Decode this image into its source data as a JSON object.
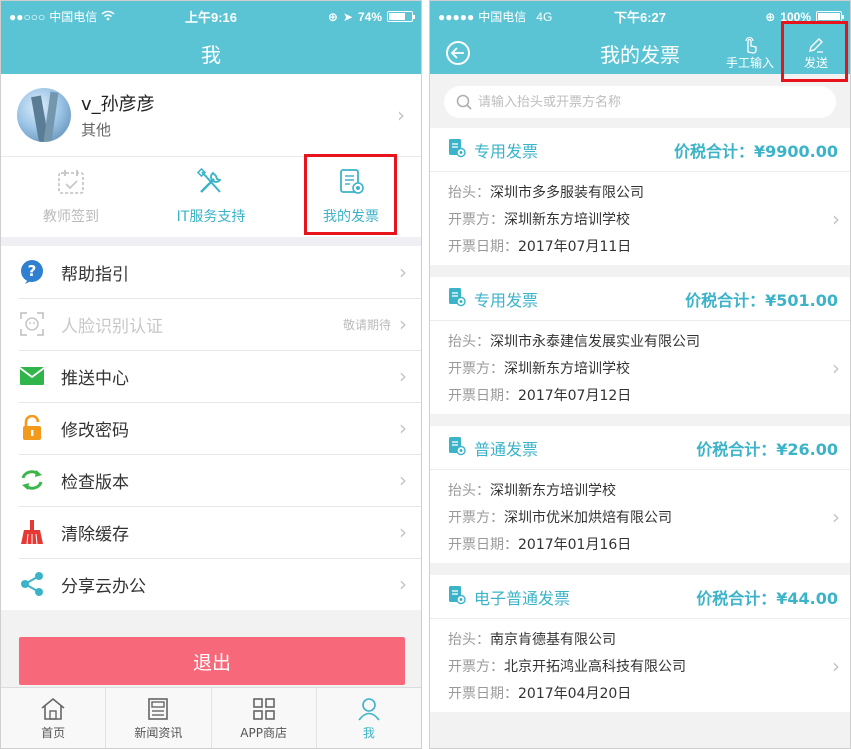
{
  "left": {
    "status": {
      "carrier": "中国电信",
      "time": "上午9:16",
      "battery": "74%",
      "battery_level": 0.74
    },
    "title": "我",
    "profile": {
      "name": "v_孙彦彦",
      "role": "其他"
    },
    "shortcuts": [
      {
        "label": "教师签到",
        "icon": "calendar-check-icon"
      },
      {
        "label": "IT服务支持",
        "icon": "tools-icon"
      },
      {
        "label": "我的发票",
        "icon": "invoice-icon"
      }
    ],
    "menu": [
      {
        "label": "帮助指引",
        "note": "",
        "icon": "help-icon"
      },
      {
        "label": "人脸识别认证",
        "note": "敬请期待",
        "icon": "face-scan-icon"
      },
      {
        "label": "推送中心",
        "note": "",
        "icon": "mail-icon"
      },
      {
        "label": "修改密码",
        "note": "",
        "icon": "lock-icon"
      },
      {
        "label": "检查版本",
        "note": "",
        "icon": "refresh-icon"
      },
      {
        "label": "清除缓存",
        "note": "",
        "icon": "broom-icon"
      },
      {
        "label": "分享云办公",
        "note": "",
        "icon": "share-icon"
      }
    ],
    "logout": "退出",
    "tabs": [
      {
        "label": "首页",
        "icon": "home-icon"
      },
      {
        "label": "新闻资讯",
        "icon": "news-icon"
      },
      {
        "label": "APP商店",
        "icon": "grid-icon"
      },
      {
        "label": "我",
        "icon": "person-icon"
      }
    ]
  },
  "right": {
    "status": {
      "carrier": "中国电信",
      "network": "4G",
      "time": "下午6:27",
      "battery": "100%",
      "battery_level": 1.0
    },
    "title": "我的发票",
    "actions": {
      "manual": "手工输入",
      "send": "发送"
    },
    "search_placeholder": "请输入抬头或开票方名称",
    "labels": {
      "header": "抬头：",
      "issuer": "开票方：",
      "date": "开票日期：",
      "total": "价税合计："
    },
    "invoices": [
      {
        "type": "专用发票",
        "total": "¥9900.00",
        "header": "深圳市多多服装有限公司",
        "issuer": "深圳新东方培训学校",
        "date": "2017年07月11日"
      },
      {
        "type": "专用发票",
        "total": "¥501.00",
        "header": "深圳市永泰建信发展实业有限公司",
        "issuer": "深圳新东方培训学校",
        "date": "2017年07月12日"
      },
      {
        "type": "普通发票",
        "total": "¥26.00",
        "header": "深圳新东方培训学校",
        "issuer": "深圳市优米加烘焙有限公司",
        "date": "2017年01月16日"
      },
      {
        "type": "电子普通发票",
        "total": "¥44.00",
        "header": "南京肯德基有限公司",
        "issuer": "北京开拓鸿业高科技有限公司",
        "date": "2017年04月20日"
      }
    ]
  }
}
